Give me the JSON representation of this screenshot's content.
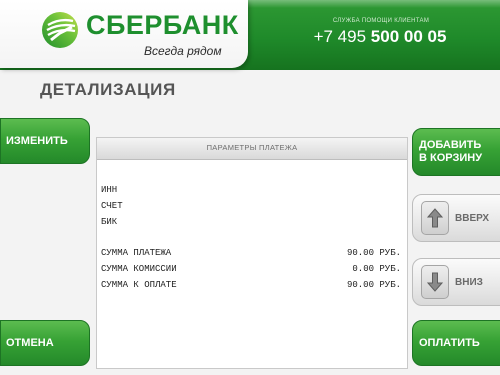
{
  "header": {
    "brand_name": "СБЕРБАНК",
    "slogan": "Всегда рядом",
    "help_caption": "СЛУЖБА ПОМОЩИ КЛИЕНТАМ",
    "phone_prefix": "+7 495 ",
    "phone_number": "500 00 05",
    "colors": {
      "brand_green": "#1e8f2e",
      "header_green": "#1f8a2a"
    }
  },
  "page": {
    "title": "ДЕТАЛИЗАЦИЯ"
  },
  "left_buttons": {
    "edit": "ИЗМЕНИТЬ",
    "cancel": "ОТМЕНА"
  },
  "right_buttons": {
    "add_to_cart_line1": "ДОБАВИТЬ",
    "add_to_cart_line2": "В КОРЗИНУ",
    "up": "ВВЕРХ",
    "down": "ВНИЗ",
    "pay": "ОПЛАТИТЬ"
  },
  "panel": {
    "header": "ПАРАМЕТРЫ ПЛАТЕЖА",
    "details": [
      {
        "label": "ИНН",
        "value": ""
      },
      {
        "label": "СЧЕТ",
        "value": ""
      },
      {
        "label": "БИК",
        "value": ""
      }
    ],
    "sums": [
      {
        "label": "СУММА ПЛАТЕЖА",
        "value": "90.00 РУБ."
      },
      {
        "label": "СУММА КОМИССИИ",
        "value": "0.00 РУБ."
      },
      {
        "label": "СУММА К ОПЛАТЕ",
        "value": "90.00 РУБ."
      }
    ]
  },
  "icons": {
    "up": "arrow-up-icon",
    "down": "arrow-down-icon",
    "logo": "sberbank-logo-icon"
  }
}
